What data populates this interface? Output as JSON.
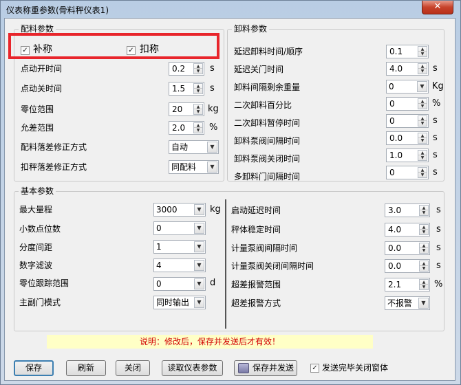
{
  "window": {
    "title": "仪表称重参数(骨料秤仪表1)",
    "close_label": "✕"
  },
  "mixing": {
    "title": "配料参数",
    "chk_bucheng": {
      "label": "补称",
      "checked": true
    },
    "chk_koucheng": {
      "label": "扣称",
      "checked": true
    },
    "jog_on": {
      "label": "点动开时间",
      "value": "0.2",
      "unit": "s"
    },
    "jog_off": {
      "label": "点动关时间",
      "value": "1.5",
      "unit": "s"
    },
    "zero_range": {
      "label": "零位范围",
      "value": "20",
      "unit": "kg"
    },
    "tolerance": {
      "label": "允差范围",
      "value": "2.0",
      "unit": "%"
    },
    "fall_mode": {
      "label": "配料落差修正方式",
      "value": "自动"
    },
    "deduct_mode": {
      "label": "扣秤落差修正方式",
      "value": "同配料"
    }
  },
  "discharge": {
    "title": "卸料参数",
    "delay_order": {
      "label": "延迟卸料时间/顺序",
      "value": "0.1"
    },
    "delay_close": {
      "label": "延迟关门时间",
      "value": "4.0",
      "unit": "s"
    },
    "interval_remain": {
      "label": "卸料间隔剩余重量",
      "value": "0",
      "unit": "Kg"
    },
    "second_pct": {
      "label": "二次卸料百分比",
      "value": "0",
      "unit": "%"
    },
    "second_pause": {
      "label": "二次卸料暂停时间",
      "value": "0",
      "unit": "s"
    },
    "pump_interval": {
      "label": "卸料泵阀间隔时间",
      "value": "0.0",
      "unit": "s"
    },
    "pump_close": {
      "label": "卸料泵阀关闭时间",
      "value": "1.0",
      "unit": "s"
    },
    "multi_gate": {
      "label": "多卸料门间隔时间",
      "value": "0",
      "unit": "s"
    }
  },
  "basic": {
    "title": "基本参数",
    "max_range": {
      "label": "最大量程",
      "value": "3000",
      "unit": "kg"
    },
    "decimals": {
      "label": "小数点位数",
      "value": "0"
    },
    "division": {
      "label": "分度间距",
      "value": "1"
    },
    "filter": {
      "label": "数字滤波",
      "value": "4"
    },
    "zero_track": {
      "label": "零位跟踪范围",
      "value": "0",
      "unit": "d"
    },
    "gate_mode": {
      "label": "主副门模式",
      "value": "同时输出"
    },
    "start_delay": {
      "label": "启动延迟时间",
      "value": "3.0",
      "unit": "s"
    },
    "stable_time": {
      "label": "秤体稳定时间",
      "value": "4.0",
      "unit": "s"
    },
    "meter_interval": {
      "label": "计量泵阀间隔时间",
      "value": "0.0",
      "unit": "s"
    },
    "meter_close": {
      "label": "计量泵阀关闭间隔时间",
      "value": "0.0",
      "unit": "s"
    },
    "over_range": {
      "label": "超差报警范围",
      "value": "2.1",
      "unit": "%"
    },
    "over_mode": {
      "label": "超差报警方式",
      "value": "不报警"
    }
  },
  "note": "说明：修改后，保存并发送后才有效！",
  "buttons": {
    "save": "保存",
    "refresh": "刷新",
    "close": "关闭",
    "read": "读取仪表参数",
    "save_send": "保存并发送",
    "close_after_send": {
      "label": "发送完毕关闭窗体",
      "checked": true
    }
  }
}
